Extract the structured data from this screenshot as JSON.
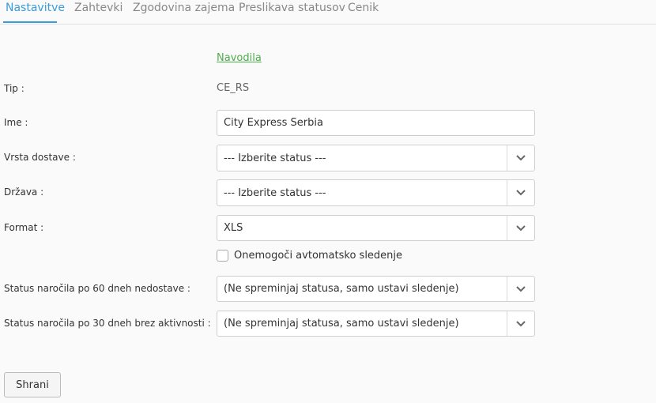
{
  "tabs": [
    {
      "label": "Nastavitve",
      "active": true
    },
    {
      "label": "Zahtevki",
      "active": false
    },
    {
      "label": "Zgodovina zajema",
      "active": false
    },
    {
      "label": "Preslikava statusov",
      "active": false
    },
    {
      "label": "Cenik",
      "active": false
    }
  ],
  "colors": {
    "accent": "#3a9bd9",
    "link": "#4cae4c"
  },
  "form": {
    "instructions_link": "Navodila",
    "tip": {
      "label": "Tip :",
      "value": "CE_RS"
    },
    "ime": {
      "label": "Ime :",
      "value": "City Express Serbia"
    },
    "vrsta_dostave": {
      "label": "Vrsta dostave :",
      "selected": "--- Izberite status ---"
    },
    "drzava": {
      "label": "Država :",
      "selected": "--- Izberite status ---"
    },
    "format": {
      "label": "Format :",
      "selected": "XLS"
    },
    "disable_tracking": {
      "label": "Onemogoči avtomatsko sledenje",
      "checked": false
    },
    "status_60": {
      "label": "Status naročila po 60 dneh nedostave :",
      "selected": "(Ne spreminjaj statusa, samo ustavi sledenje)"
    },
    "status_30": {
      "label": "Status naročila po 30 dneh brez aktivnosti :",
      "selected": "(Ne spreminjaj statusa, samo ustavi sledenje)"
    },
    "save_label": "Shrani"
  },
  "icons": {
    "select_arrow": "chevron-down-icon"
  }
}
